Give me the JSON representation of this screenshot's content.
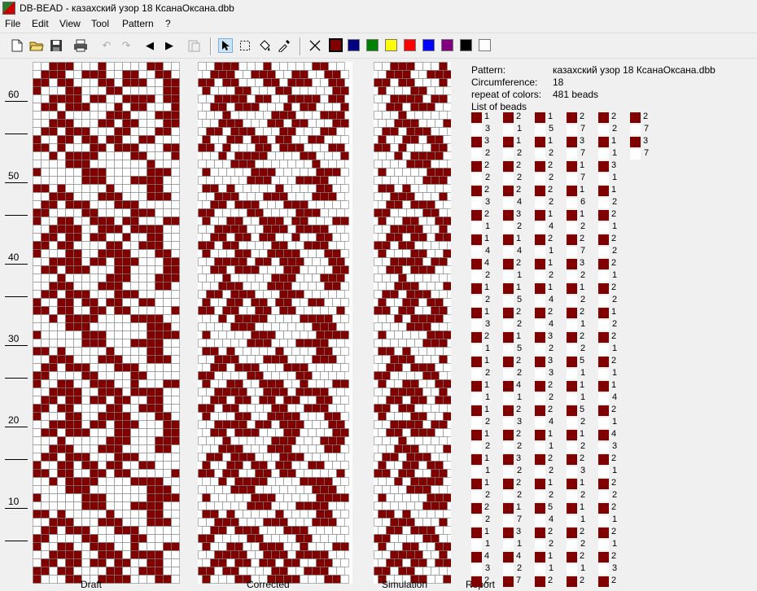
{
  "window": {
    "title": "DB-BEAD - казахский узор 18 КсанаОксана.dbb"
  },
  "menu": [
    "File",
    "Edit",
    "View",
    "Tool",
    "Pattern",
    "?"
  ],
  "toolbar": {
    "icons": [
      "new-icon",
      "open-icon",
      "save-icon",
      "print-icon",
      "undo-icon",
      "redo-icon",
      "arrow-left-icon",
      "arrow-right-icon",
      "clipboard-icon",
      "pointer-icon",
      "select-icon",
      "fill-icon",
      "eyedropper-icon",
      "delete-icon"
    ],
    "colors": [
      "#800000",
      "#000080",
      "#008000",
      "#ffff00",
      "#ff0000",
      "#0000ff",
      "#800080",
      "#000000",
      "#ffffff"
    ]
  },
  "ruler": {
    "labels": [
      "60",
      "50",
      "40",
      "30",
      "20",
      "10"
    ]
  },
  "panels": {
    "draft": "Draft",
    "corrected": "Corrected",
    "simulation": "Simulation",
    "report": "Report"
  },
  "pattern": {
    "colors": {
      "bead": "#800000",
      "background": "#ffffff"
    },
    "rows": [
      "001110001000001100",
      "011100111001100110",
      "110110001101110011",
      "100011000110000011",
      "001111011001111011",
      "011011100010110001",
      "000100000111000111",
      "001110001101100011",
      "011011100011000110",
      "100110110110011000",
      "110100011011100011",
      "001011110000110001",
      "000011100000001000",
      "100000111000001110",
      "000000111000111100",
      "110100000100001100",
      "001110001110001110",
      "011011100011100000",
      "110000110000111000",
      "100110011101100011",
      "001111001110111100",
      "011011011001001100",
      "110110000110011100",
      "100011001111000110",
      "001111011011100011",
      "011011100011000011",
      "000100000111000111",
      "001110001110000110",
      "011011100011100000",
      "100110110110011000",
      "110110011011000001",
      "001011110000111100",
      "000011100000001110",
      "100000111000001111",
      "000000111000111100",
      "110100000100001100",
      "001110001110001110",
      "011011100011100000",
      "110000110000110000",
      "100110011100100011",
      "001111001110111100",
      "011011011011001100",
      "110110000110011100",
      "100011001111000110",
      "001111011011100011",
      "011011100011000011",
      "000100000111000111",
      "001110001110000110",
      "011011100011100000",
      "100110110110011000",
      "110110011011000001",
      "001011110000111100",
      "000011100000001110",
      "100000111000001111",
      "000000111000111100",
      "110100000100001100",
      "001110001110001110",
      "011011100011100000",
      "110000110000110000",
      "100110011100100011",
      "001111001110111100",
      "011011011011001100",
      "110110000110011100",
      "100011001111000110"
    ]
  },
  "report": {
    "pattern_label": "Pattern:",
    "pattern_value": "казахский узор 18 КсанаОксана.dbb",
    "circumference_label": "Circumference:",
    "circumference_value": "18",
    "repeat_label": "repeat of colors:",
    "repeat_value": "481 beads",
    "list_label": "List of beads",
    "columns": [
      [
        "1",
        "3",
        "3",
        "2",
        "2",
        "2",
        "2",
        "3",
        "2",
        "1",
        "1",
        "4",
        "4",
        "2",
        "1",
        "2",
        "1",
        "3",
        "2",
        "1",
        "1",
        "2",
        "1",
        "1",
        "1",
        "2",
        "1",
        "2",
        "1",
        "1",
        "1",
        "2",
        "2",
        "2",
        "1",
        "1",
        "4",
        "3",
        "2",
        "1",
        "2",
        "1",
        "3",
        "2",
        "1",
        "1",
        "2"
      ],
      [
        "2",
        "1",
        "1",
        "2",
        "2",
        "2",
        "2",
        "4",
        "3",
        "2",
        "1",
        "4",
        "2",
        "1",
        "1",
        "5",
        "2",
        "2",
        "1",
        "5",
        "2",
        "2",
        "4",
        "1",
        "2",
        "3",
        "2",
        "2",
        "3",
        "2",
        "2",
        "2",
        "1",
        "7",
        "3",
        "1",
        "4",
        "2",
        "7",
        "3",
        "1",
        "4",
        "6",
        "2",
        "2",
        "1",
        "3",
        "7"
      ],
      [
        "1",
        "5",
        "1",
        "2",
        "2",
        "2",
        "2",
        "2",
        "1",
        "4",
        "2",
        "1",
        "1",
        "2",
        "1",
        "4",
        "2",
        "4",
        "3",
        "2",
        "3",
        "3",
        "2",
        "2",
        "2",
        "4",
        "1",
        "1",
        "2",
        "2",
        "1",
        "2",
        "5",
        "4",
        "2",
        "2",
        "1",
        "1",
        "2",
        "2",
        "2",
        "1",
        "2",
        "1",
        "2",
        "1",
        "4"
      ],
      [
        "2",
        "7",
        "3",
        "7",
        "1",
        "7",
        "1",
        "6",
        "1",
        "2",
        "2",
        "7",
        "3",
        "2",
        "1",
        "2",
        "2",
        "1",
        "2",
        "2",
        "5",
        "1",
        "1",
        "1",
        "5",
        "2",
        "1",
        "2",
        "2",
        "3",
        "1",
        "2",
        "1",
        "1",
        "2",
        "2",
        "2",
        "1",
        "2",
        "1",
        "2",
        "1",
        "2",
        "1"
      ],
      [
        "2",
        "2",
        "1",
        "1",
        "3",
        "1",
        "1",
        "2",
        "2",
        "1",
        "2",
        "2",
        "2",
        "1",
        "2",
        "2",
        "1",
        "2",
        "2",
        "1",
        "2",
        "1",
        "1",
        "4",
        "2",
        "1",
        "4",
        "3",
        "2",
        "1",
        "2",
        "2",
        "2",
        "1",
        "2",
        "1",
        "2",
        "3",
        "2",
        "2"
      ],
      [
        "2",
        "7",
        "3",
        "7"
      ]
    ]
  }
}
